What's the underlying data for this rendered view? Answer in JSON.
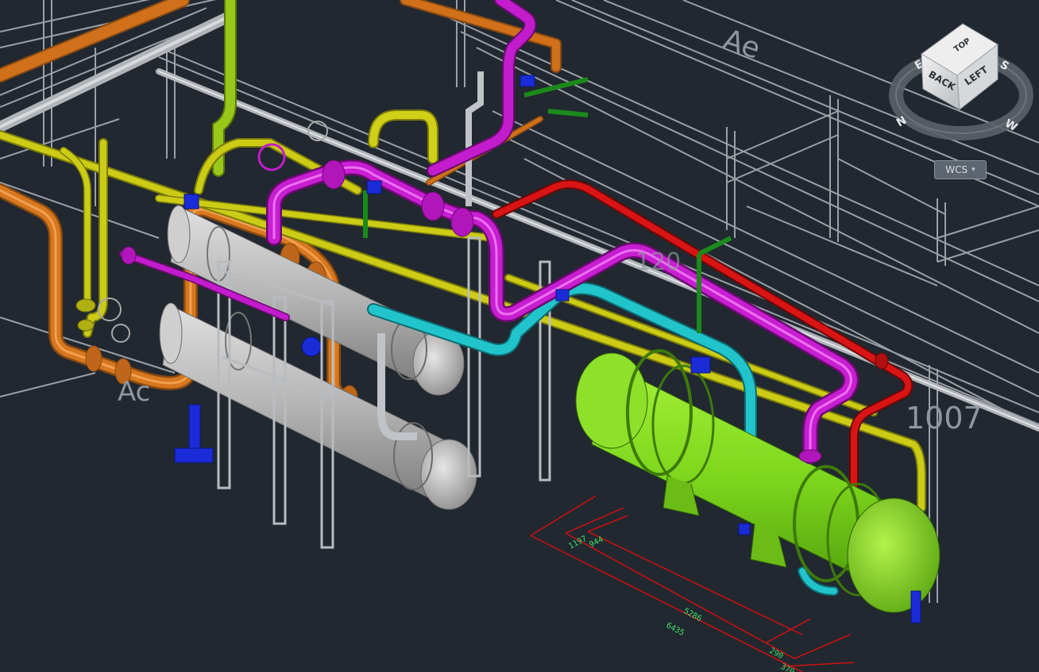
{
  "viewcube": {
    "faces": {
      "top": "TOP",
      "back": "BACK",
      "left": "LEFT"
    },
    "compass": {
      "n": "N",
      "e": "E",
      "s": "S",
      "w": "W"
    }
  },
  "wcs_menu": {
    "label": "WCS",
    "caret": "▾"
  },
  "annotations": {
    "text_ae_top": "Ae",
    "text_ac_left": "Ac",
    "text_1007": "1007",
    "text_120": "120"
  },
  "dimensions": {
    "d1197": "1197",
    "d944": "944",
    "d5286": "5286",
    "d6435": "6435",
    "d290": "290",
    "d370": "370"
  },
  "colors": {
    "background": "#212830",
    "steel": "#9aa0a6",
    "pipe_orange": "#d0701a",
    "pipe_yellow": "#c8c814",
    "pipe_magenta": "#c018c8",
    "pipe_cyan": "#20c0c8",
    "pipe_red": "#d81414",
    "pipe_lime": "#94c81a",
    "exchanger_green": "#7ed81c",
    "vessel_gray": "#b8b8b8",
    "support_blue": "#1a2cd8",
    "dimension_red": "#d01010",
    "dimension_text": "#3fe06a"
  }
}
